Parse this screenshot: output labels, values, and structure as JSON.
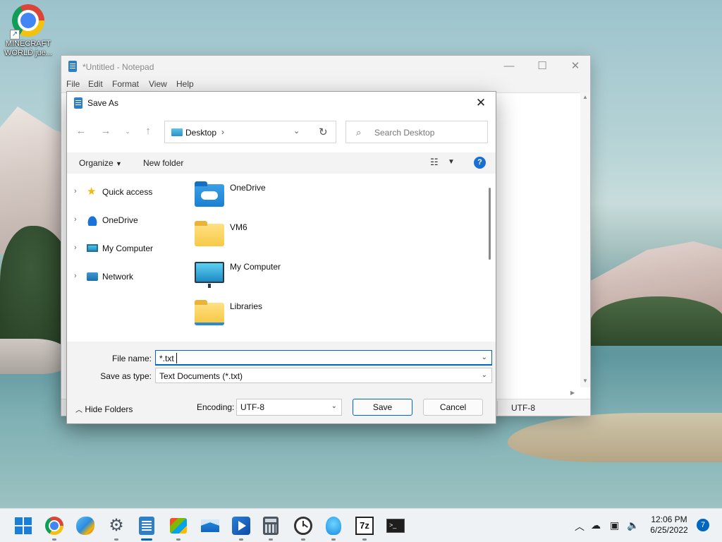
{
  "desktop": {
    "shortcut_label": "MINECRAFT WORLD jue..."
  },
  "notepad": {
    "title": "*Untitled - Notepad",
    "menu": [
      "File",
      "Edit",
      "Format",
      "View",
      "Help"
    ],
    "status_encoding": "UTF-8"
  },
  "dialog": {
    "title": "Save As",
    "address": "Desktop",
    "search_placeholder": "Search Desktop",
    "organize_label": "Organize",
    "new_folder_label": "New folder",
    "nav": [
      {
        "label": "Quick access",
        "icon": "star-icon"
      },
      {
        "label": "OneDrive",
        "icon": "cloud-icon"
      },
      {
        "label": "My Computer",
        "icon": "monitor-icon"
      },
      {
        "label": "Network",
        "icon": "network-icon"
      }
    ],
    "files": [
      {
        "label": "OneDrive",
        "icon": "onedrive-folder-icon"
      },
      {
        "label": "VM6",
        "icon": "folder-icon"
      },
      {
        "label": "My Computer",
        "icon": "monitor-icon"
      },
      {
        "label": "Libraries",
        "icon": "library-folder-icon"
      }
    ],
    "file_name_label": "File name:",
    "file_name_value": "*.txt",
    "save_type_label": "Save as type:",
    "save_type_value": "Text Documents (*.txt)",
    "hide_folders_label": "Hide Folders",
    "encoding_label": "Encoding:",
    "encoding_value": "UTF-8",
    "save_label": "Save",
    "cancel_label": "Cancel"
  },
  "taskbar": {
    "time": "12:06 PM",
    "date": "6/25/2022",
    "notification_count": "7",
    "apps": [
      "start-icon",
      "chrome-icon",
      "paint-icon",
      "settings-icon",
      "notepad-icon",
      "store-icon",
      "mail-icon",
      "media-player-icon",
      "calculator-icon",
      "clock-icon",
      "tips-icon",
      "7zip-icon",
      "terminal-icon"
    ]
  }
}
